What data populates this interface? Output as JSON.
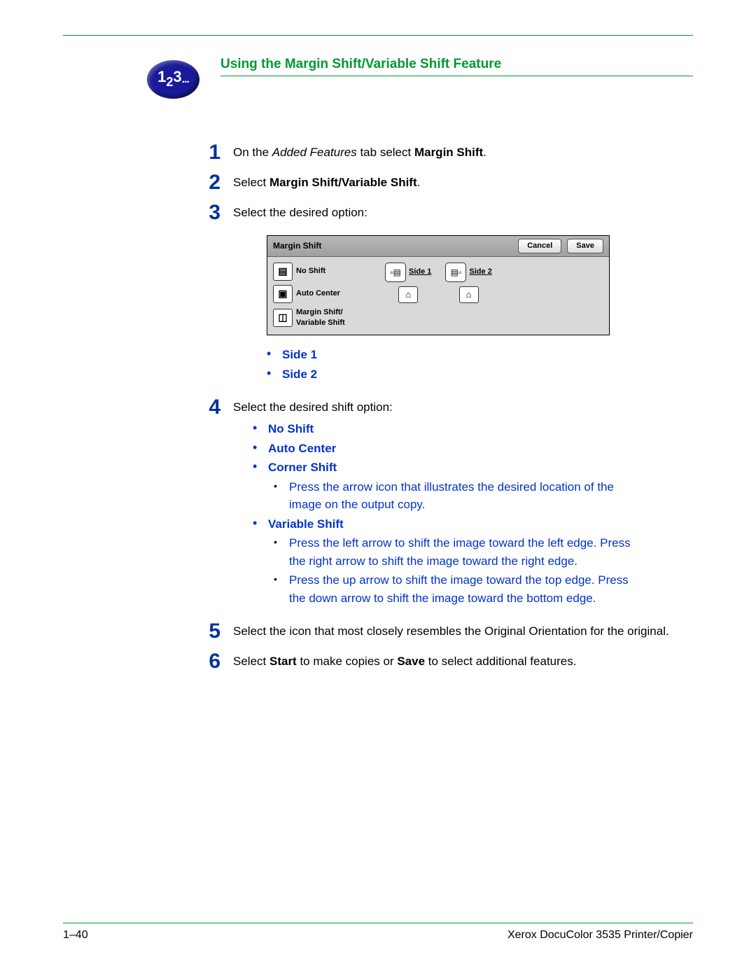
{
  "heading": "Using the Margin Shift/Variable Shift Feature",
  "icon_label": {
    "n1": "1",
    "n2": "2",
    "n3": "3",
    "dots": "..."
  },
  "steps": {
    "s1": {
      "num": "1",
      "pre": "On the ",
      "italic": "Added Features",
      "mid": " tab select ",
      "bold": "Margin Shift",
      "post": "."
    },
    "s2": {
      "num": "2",
      "pre": "Select ",
      "bold": "Margin Shift/Variable Shift",
      "post": "."
    },
    "s3": {
      "num": "3",
      "text": "Select the desired option:"
    },
    "s3_side_bullets": [
      "Side 1",
      "Side 2"
    ],
    "s4": {
      "num": "4",
      "text": "Select the desired shift option:"
    },
    "s4_options": {
      "no_shift": "No Shift",
      "auto_center": "Auto Center",
      "corner_shift": "Corner Shift",
      "corner_sub": "Press the arrow icon that illustrates the desired location of the image on the output copy.",
      "variable_shift": "Variable Shift",
      "variable_sub1": "Press the left arrow to shift the image toward the left edge. Press the right arrow to shift the image toward the right edge.",
      "variable_sub2": "Press the up arrow to shift the image toward the top edge. Press the down arrow to shift the image toward the bottom edge."
    },
    "s5": {
      "num": "5",
      "text": "Select the icon that most closely resembles the Original Orientation for the original."
    },
    "s6": {
      "num": "6",
      "pre": "Select ",
      "b1": "Start",
      "mid": " to make copies or ",
      "b2": "Save",
      "post": " to select additional features."
    }
  },
  "screenshot": {
    "title": "Margin Shift",
    "cancel": "Cancel",
    "save": "Save",
    "opts": {
      "no_shift": "No Shift",
      "auto_center": "Auto Center",
      "margin_var1": "Margin Shift/",
      "margin_var2": "Variable Shift"
    },
    "side1": "Side 1",
    "side2": "Side 2"
  },
  "footer": {
    "page": "1–40",
    "product": "Xerox DocuColor 3535 Printer/Copier"
  }
}
